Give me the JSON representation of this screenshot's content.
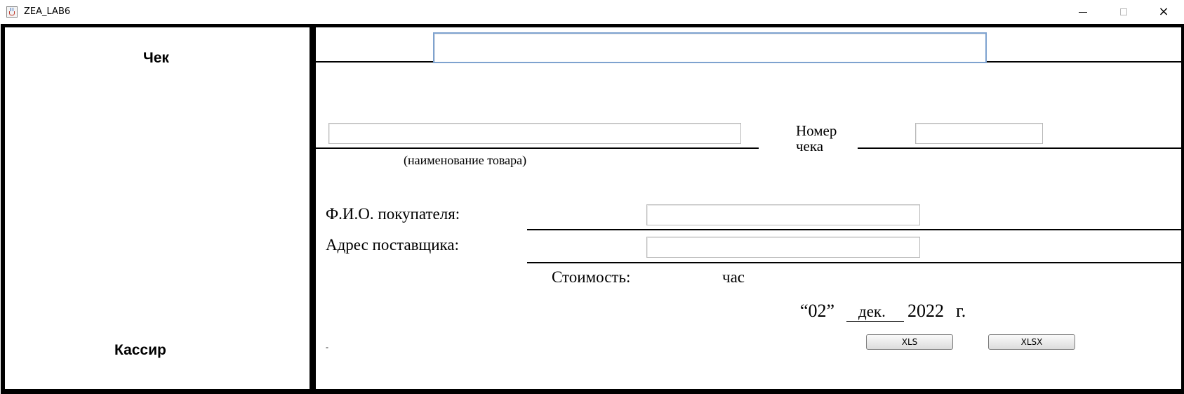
{
  "window": {
    "title": "ZEA_LAB6",
    "icon": "java-cup-icon",
    "controls": {
      "minimize": "minimize-icon",
      "maximize": "maximize-icon",
      "close": "×"
    }
  },
  "left_panel": {
    "heading": "Чек",
    "footer": "Кассир"
  },
  "form": {
    "top_field_value": "",
    "product_field_value": "",
    "product_caption": "(наименование товара)",
    "receipt_number_label_line1": "Номер",
    "receipt_number_label_line2": "чека",
    "receipt_number_value": "",
    "buyer_label": "Ф.И.О. покупателя:",
    "buyer_value": "",
    "supplier_label": "Адрес поставщика:",
    "supplier_value": "",
    "cost_label": "Стоимость:",
    "cost_unit": "час",
    "date_day": "“02”",
    "date_month": "дек.",
    "date_year": "2022",
    "date_suffix": "г.",
    "small_mark": "-"
  },
  "buttons": {
    "xls": "XLS",
    "xlsx": "XLSX"
  }
}
